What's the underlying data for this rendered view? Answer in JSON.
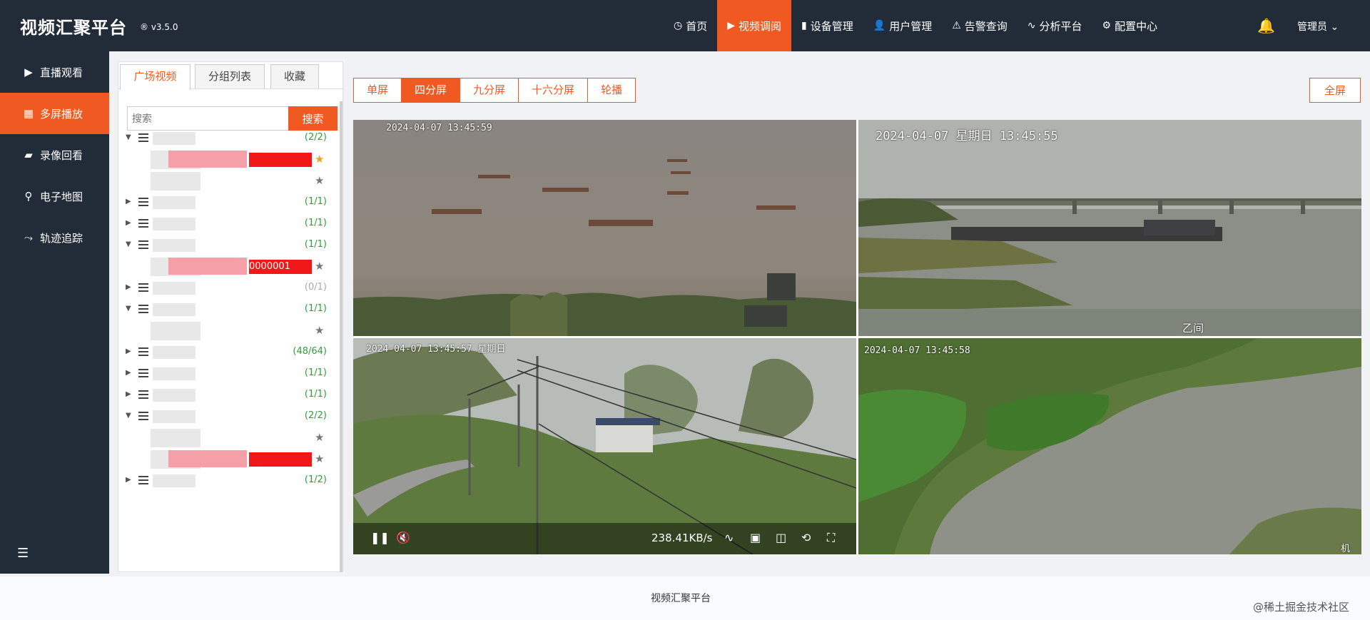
{
  "header": {
    "brand": "视频汇聚平台",
    "version": "® v3.5.0",
    "nav": [
      {
        "label": "首页",
        "icon": "dashboard-icon",
        "glyph": "◷"
      },
      {
        "label": "视频调阅",
        "icon": "play-circle-icon",
        "glyph": "▶",
        "active": true
      },
      {
        "label": "设备管理",
        "icon": "device-icon",
        "glyph": "▮"
      },
      {
        "label": "用户管理",
        "icon": "user-icon",
        "glyph": "👤"
      },
      {
        "label": "告警查询",
        "icon": "alarm-icon",
        "glyph": "⚠"
      },
      {
        "label": "分析平台",
        "icon": "pulse-icon",
        "glyph": "∿"
      },
      {
        "label": "配置中心",
        "icon": "gear-icon",
        "glyph": "⚙"
      }
    ],
    "user": "管理员 ⌄"
  },
  "sidebar": {
    "items": [
      {
        "label": "直播观看",
        "glyph": "▶"
      },
      {
        "label": "多屏播放",
        "glyph": "▦",
        "active": true
      },
      {
        "label": "录像回看",
        "glyph": "▰"
      },
      {
        "label": "电子地图",
        "glyph": "⚲"
      },
      {
        "label": "轨迹追踪",
        "glyph": "⤳"
      }
    ]
  },
  "tree": {
    "tabs": [
      "广场视频",
      "分组列表",
      "收藏"
    ],
    "search_placeholder": "搜索",
    "search_button": "搜索",
    "rows": [
      {
        "caret": "▼",
        "icon": true,
        "count": "(2/2)"
      },
      {
        "star": "gold",
        "redbar": true
      },
      {
        "star": "gray"
      },
      {
        "caret": "▶",
        "icon": true,
        "count": "(1/1)"
      },
      {
        "caret": "▶",
        "icon": true,
        "count": "(1/1)"
      },
      {
        "caret": "▼",
        "icon": true,
        "count": "(1/1)"
      },
      {
        "star": "gray",
        "redbar_text": "0000001"
      },
      {
        "caret": "▶",
        "icon": true,
        "count": "(0/1)",
        "gray": true
      },
      {
        "caret": "▼",
        "icon": true,
        "count": "(1/1)"
      },
      {
        "star": "gray"
      },
      {
        "caret": "▶",
        "icon": true,
        "count": "(48/64)"
      },
      {
        "caret": "▶",
        "icon": true,
        "count": "(1/1)"
      },
      {
        "caret": "▶",
        "icon": true,
        "count": "(1/1)"
      },
      {
        "caret": "▼",
        "icon": true,
        "count": "(2/2)"
      },
      {
        "star": "gray"
      },
      {
        "star": "gray",
        "redbar": true
      },
      {
        "caret": "▶",
        "icon": true,
        "count": "(1/2)"
      }
    ]
  },
  "modes": [
    "单屏",
    "四分屏",
    "九分屏",
    "十六分屏",
    "轮播"
  ],
  "active_mode": "四分屏",
  "fullscreen": "全屏",
  "videos": [
    {
      "timestamp": "2024-04-07 13:45:59"
    },
    {
      "timestamp": "2024-04-07 星期日 13:45:55",
      "corner": "乙间"
    },
    {
      "timestamp": "2024-04-07 13:45:57 星期日"
    },
    {
      "timestamp": "2024-04-07 13:45:58",
      "corner": "机"
    }
  ],
  "player": {
    "speed": "238.41KB/s"
  },
  "footer": "视频汇聚平台",
  "watermark": "@稀土掘金技术社区"
}
